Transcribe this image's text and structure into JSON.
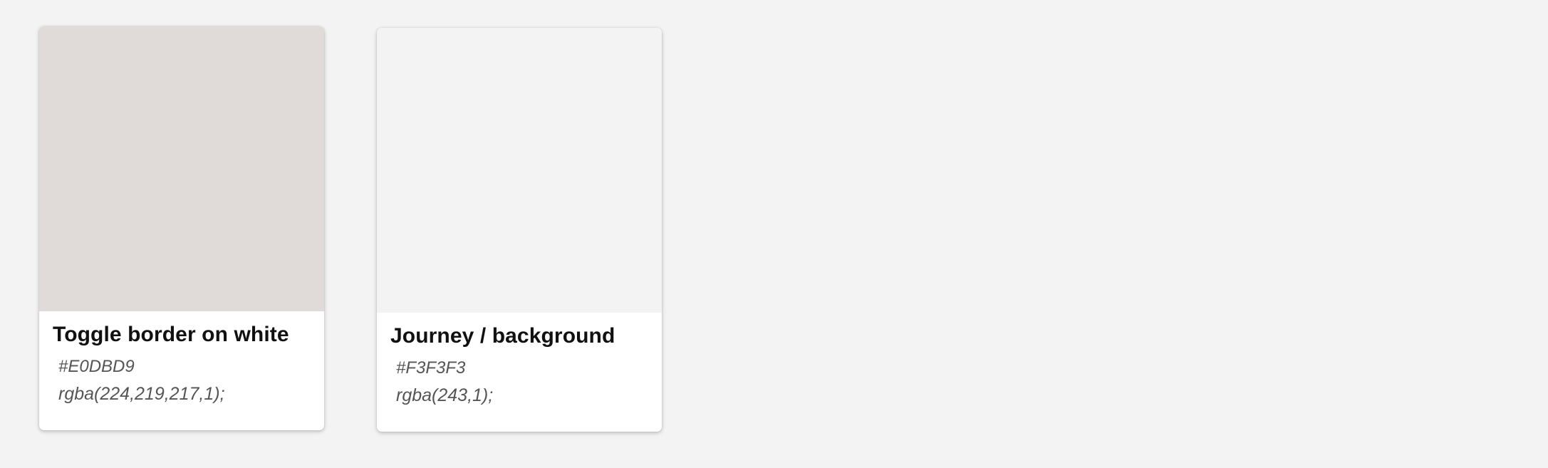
{
  "swatches": [
    {
      "name": "Toggle border on white",
      "hex": "#E0DBD9",
      "rgba": "rgba(224,219,217,1);",
      "color": "#E0DBD9"
    },
    {
      "name": "Journey / background",
      "hex": "#F3F3F3",
      "rgba": "rgba(243,1);",
      "color": "#F3F3F3"
    }
  ]
}
